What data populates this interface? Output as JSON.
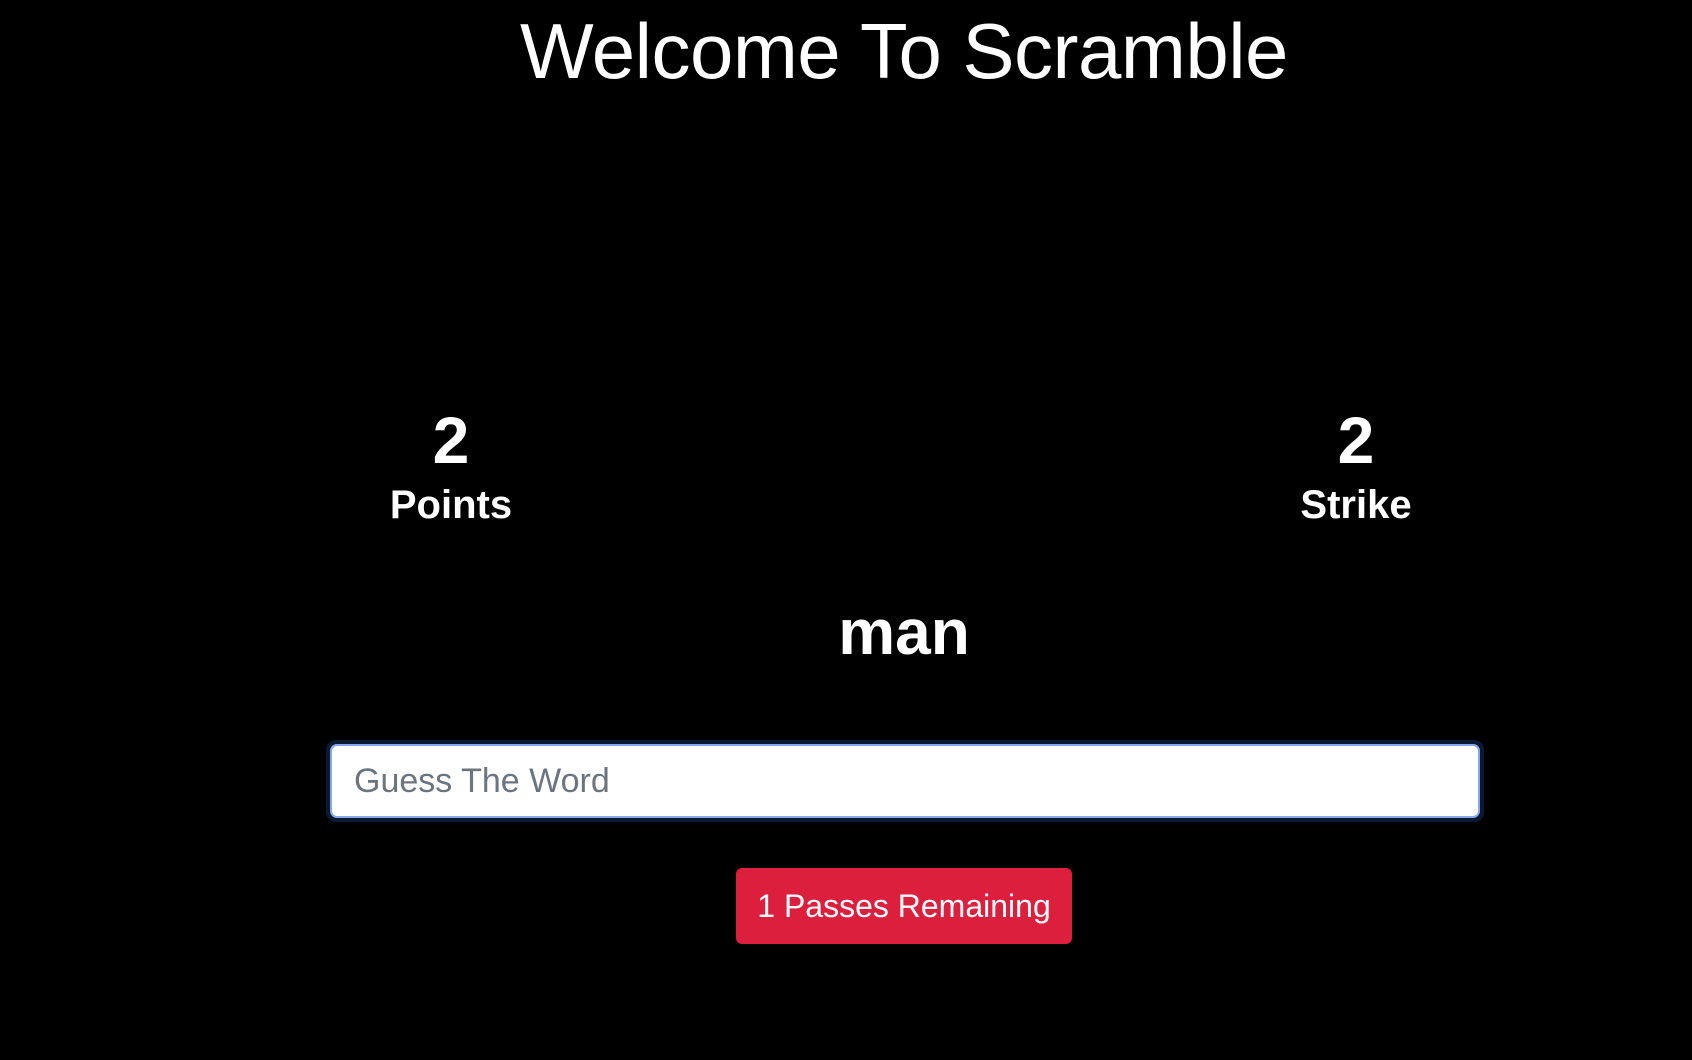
{
  "header": {
    "title": "Welcome To Scramble"
  },
  "stats": {
    "points_value": "2",
    "points_label": "Points",
    "strikes_value": "2",
    "strikes_label": "Strike"
  },
  "scrambled_word": "man",
  "guess": {
    "value": "",
    "placeholder": "Guess The Word"
  },
  "pass_button": {
    "label": "1 Passes Remaining",
    "color": "#dc1f3c"
  },
  "colors": {
    "background": "#000000",
    "text": "#ffffff"
  }
}
